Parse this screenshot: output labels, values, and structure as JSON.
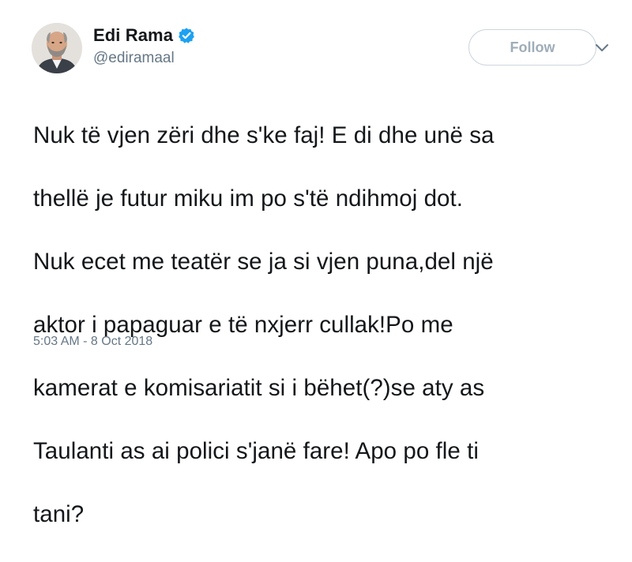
{
  "user": {
    "display_name": "Edi Rama",
    "handle": "@ediramaal",
    "verified": true
  },
  "actions": {
    "follow_label": "Follow",
    "more_icon": "chevron-down-icon"
  },
  "tweet": {
    "lines": [
      "Nuk të vjen zëri dhe s'ke faj! E di dhe unë sa",
      "thellë je futur miku im po s'të ndihmoj dot.",
      "Nuk ecet me teatër se ja si vjen puna,del një",
      "aktor i papaguar e të nxjerr cullak!Po me",
      "kamerat e komisariatit si i bëhet(?)se aty as",
      "Taulanti as ai polici s'janë fare! Apo po fle ti",
      "tani?"
    ],
    "timestamp": "5:03 AM - 8 Oct 2018"
  },
  "colors": {
    "verified_blue": "#1da1f2",
    "text": "#14171a",
    "muted": "#657786",
    "follow_border": "#ccd6dd"
  }
}
